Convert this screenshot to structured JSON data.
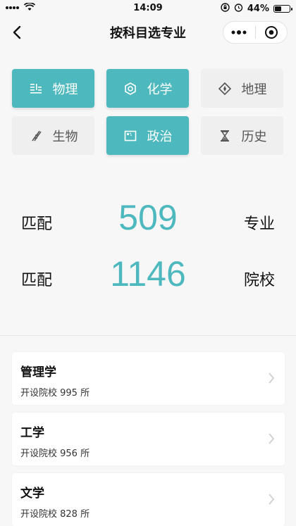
{
  "status": {
    "time": "14:09",
    "battery": "44%",
    "battery_level": 0.44
  },
  "nav": {
    "title": "按科目选专业"
  },
  "subjects": [
    {
      "label": "物理",
      "icon": "physics-icon",
      "selected": true
    },
    {
      "label": "化学",
      "icon": "chemistry-icon",
      "selected": true
    },
    {
      "label": "地理",
      "icon": "geography-icon",
      "selected": false
    },
    {
      "label": "生物",
      "icon": "biology-icon",
      "selected": false
    },
    {
      "label": "政治",
      "icon": "politics-icon",
      "selected": true
    },
    {
      "label": "历史",
      "icon": "history-icon",
      "selected": false
    }
  ],
  "stats": {
    "majors": {
      "prefix": "匹配",
      "value": "509",
      "unit": "专业"
    },
    "schools": {
      "prefix": "匹配",
      "value": "1146",
      "unit": "院校"
    }
  },
  "majors": [
    {
      "name": "管理学",
      "schools": "开设院校 995 所"
    },
    {
      "name": "工学",
      "schools": "开设院校 956 所"
    },
    {
      "name": "文学",
      "schools": "开设院校 828 所"
    }
  ],
  "colors": {
    "accent": "#4db8bd",
    "inactive_bg": "#efefef"
  }
}
